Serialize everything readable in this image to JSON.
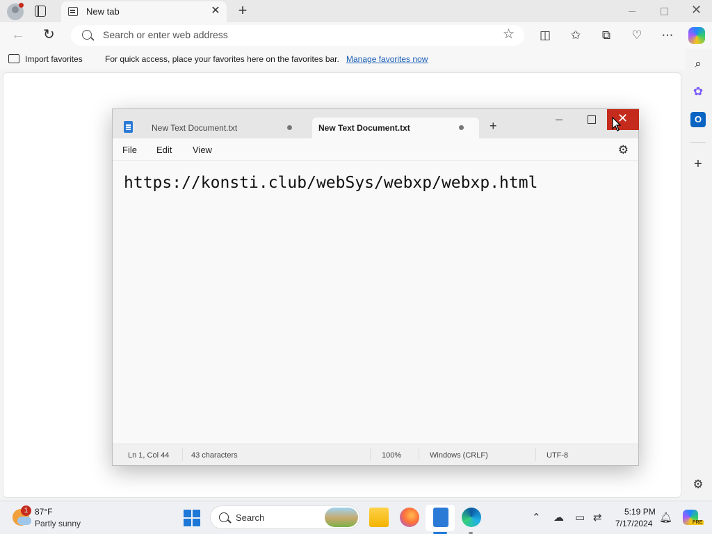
{
  "browser": {
    "tab_title": "New tab",
    "tab_close": "✕",
    "new_tab": "+",
    "address_placeholder": "Search or enter web address",
    "close_symbol": "✕"
  },
  "favorites_bar": {
    "import_label": "Import favorites",
    "hint_text": "For quick access, place your favorites here on the favorites bar.",
    "manage_link": "Manage favorites now"
  },
  "toolbar_icons": [
    "split-screen-icon",
    "favorites-icon",
    "collections-icon",
    "browser-essentials-icon",
    "more-icon",
    "copilot-icon"
  ],
  "sidebar_icons": [
    "search-icon",
    "copilot-sidebar-icon",
    "outlook-icon",
    "add-icon",
    "settings-icon"
  ],
  "notepad": {
    "tabs": [
      {
        "title": "New Text Document.txt",
        "active": false
      },
      {
        "title": "New Text Document.txt",
        "active": true
      }
    ],
    "new_tab": "+",
    "close_symbol": "✕",
    "menu": {
      "file": "File",
      "edit": "Edit",
      "view": "View"
    },
    "content": "https://konsti.club/webSys/webxp/webxp.html",
    "status": {
      "position": "Ln 1, Col 44",
      "characters": "43 characters",
      "zoom": "100%",
      "line_ending": "Windows (CRLF)",
      "encoding": "UTF-8"
    }
  },
  "taskbar": {
    "weather": {
      "badge": "1",
      "temp": "87°F",
      "desc": "Partly sunny"
    },
    "search_label": "Search",
    "pinned_apps": [
      "file-explorer-icon",
      "firefox-icon",
      "notepad-icon",
      "edge-icon"
    ],
    "clock": {
      "time": "5:19 PM",
      "date": "7/17/2024"
    },
    "copilot_badge": "PRE"
  },
  "colors": {
    "accent": "#1e78d8",
    "close_red": "#c42b1c",
    "link": "#1a5fb4"
  }
}
